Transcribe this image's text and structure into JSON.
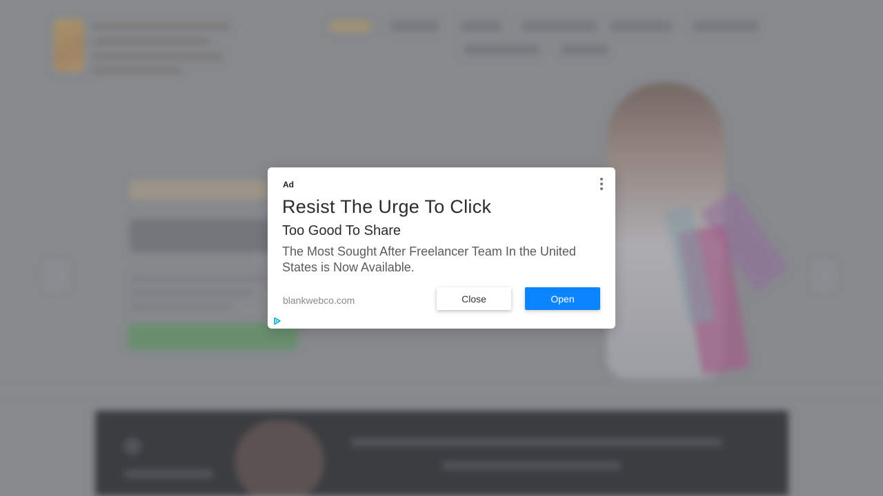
{
  "ad": {
    "label": "Ad",
    "headline": "Resist The Urge To Click",
    "subheadline": "Too Good To Share",
    "body": "The Most Sought After Freelancer Team In the United States is Now Available.",
    "domain": "blankwebco.com",
    "close_label": "Close",
    "open_label": "Open",
    "icons": {
      "menu": "more-vertical-icon",
      "adchoices": "adchoices-icon"
    },
    "colors": {
      "open_button": "#0a84ff",
      "adchoices": "#00aecd"
    }
  }
}
